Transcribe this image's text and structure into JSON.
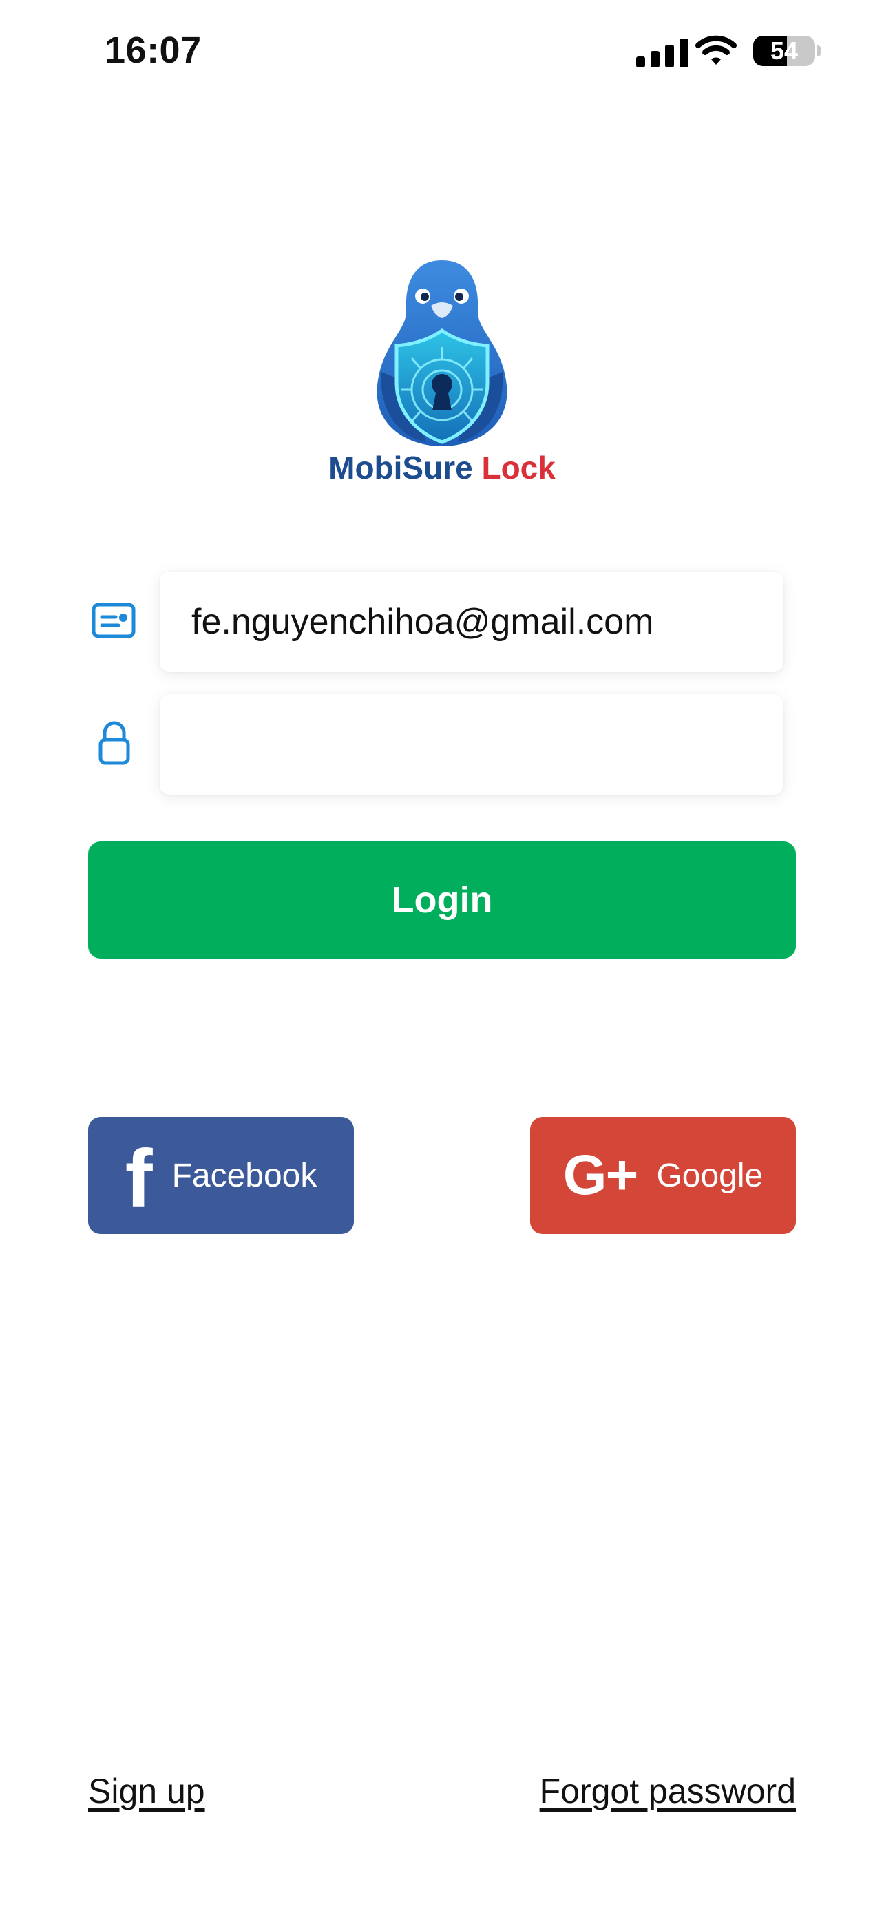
{
  "status_bar": {
    "time": "16:07",
    "battery": "54",
    "icons": [
      "signal-icon",
      "wifi-icon",
      "battery-icon"
    ]
  },
  "brand": {
    "name_part1": "MobiSure",
    "name_part2": "Lock",
    "color_primary": "#1d4c8f",
    "color_accent": "#d9303a",
    "logo_icon": "pigeon-shield-keyhole-logo"
  },
  "login_form": {
    "email_icon": "id-card-icon",
    "email_value": "fe.nguyenchihoa@gmail.com",
    "password_icon": "lock-icon",
    "password_value": "",
    "login_label": "Login",
    "login_color": "#00ae5b"
  },
  "social": {
    "facebook_label": "Facebook",
    "facebook_color": "#3c5a99",
    "google_label": "Google",
    "google_color": "#d44638"
  },
  "footer": {
    "signup_label": "Sign up",
    "forgot_label": "Forgot password"
  }
}
